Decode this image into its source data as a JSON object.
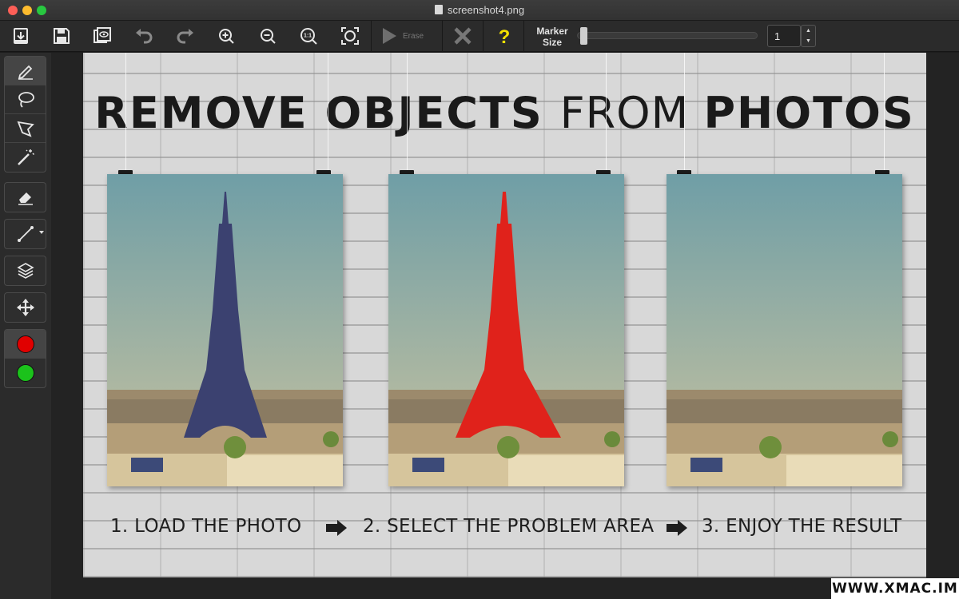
{
  "window": {
    "title": "screenshot4.png"
  },
  "toolbar": {
    "icons": [
      "open-icon",
      "save-icon",
      "save-copy-icon",
      "undo-icon",
      "redo-icon",
      "zoom-in-icon",
      "zoom-out-icon",
      "actual-size-icon",
      "fit-screen-icon",
      "play-icon",
      "cancel-icon",
      "help-icon"
    ],
    "erase_label": "Erase",
    "help_glyph": "?",
    "actual_size_glyph": "1:1",
    "marker_label_line1": "Marker",
    "marker_label_line2": "Size",
    "marker_size_value": "1",
    "marker_slider_level": 0.02,
    "stepper_up": "▲",
    "stepper_down": "▼"
  },
  "palette": {
    "tools": [
      "marker-icon",
      "lasso-icon",
      "polygon-lasso-icon",
      "magic-wand-icon",
      "eraser-icon",
      "line-icon",
      "layers-icon",
      "move-icon"
    ],
    "colors": {
      "red": "#e00000",
      "green": "#1bc21b"
    }
  },
  "canvas": {
    "headline": {
      "part1": "REMOVE OBJECTS ",
      "part2": "FROM ",
      "part3": "PHOTOS"
    },
    "steps": [
      "1. LOAD THE PHOTO",
      "2. SELECT THE PROBLEM AREA",
      "3. ENJOY THE RESULT"
    ],
    "colors": {
      "sky_top": "#6f9ea6",
      "sky_bottom": "#c9c3a0",
      "tower": "#3b4170",
      "tower_selected": "#e0221b"
    }
  },
  "watermark": "WWW.XMAC.IM"
}
